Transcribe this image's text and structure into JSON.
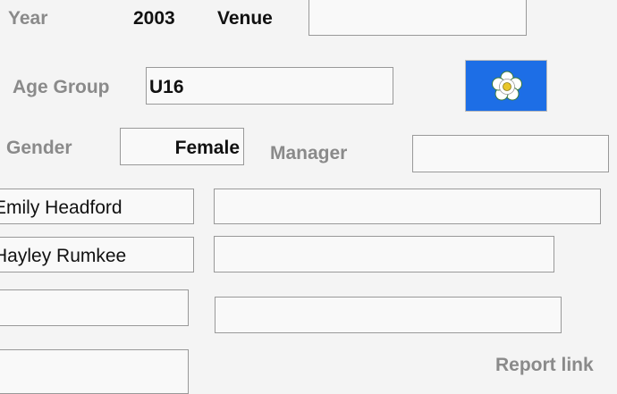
{
  "form": {
    "year_label": "Year",
    "year_value": "2003",
    "venue_label": "Venue",
    "venue_value": "",
    "age_group_label": "Age Group",
    "age_group_value": "U16",
    "gender_label": "Gender",
    "gender_value": "Female",
    "manager_label": "Manager",
    "manager_value": "",
    "report_link_label": "Report link"
  },
  "players": [
    {
      "name": "Emily Headford",
      "detail": ""
    },
    {
      "name": "Hayley Rumkee",
      "detail": ""
    },
    {
      "name": "",
      "detail": ""
    },
    {
      "name": "",
      "detail": ""
    }
  ],
  "flag": {
    "icon": "yorkshire-rose-flag-icon",
    "background": "#1d6ee6",
    "rose": "#ffffff",
    "center": "#e8c62a"
  }
}
